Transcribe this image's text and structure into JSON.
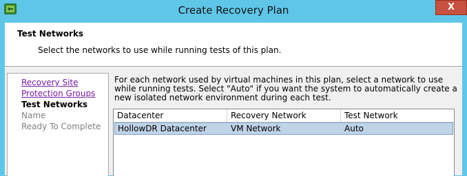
{
  "window": {
    "title": "Create Recovery Plan",
    "close_label": "X",
    "app_icon": "vmware-srm-icon"
  },
  "header": {
    "title": "Test Networks",
    "subtitle": "Select the networks to use while running tests of this plan."
  },
  "nav": {
    "items": [
      {
        "label": "Recovery Site",
        "state": "link"
      },
      {
        "label": "Protection Groups",
        "state": "link"
      },
      {
        "label": "Test Networks",
        "state": "current"
      },
      {
        "label": "Name",
        "state": "disabled"
      },
      {
        "label": "Ready To Complete",
        "state": "disabled"
      }
    ]
  },
  "main": {
    "description": "For each network used by virtual machines in this plan, select a network to use while running tests. Select \"Auto\" if you want the system to automatically create a new isolated network environment during each test.",
    "table": {
      "columns": [
        "Datacenter",
        "Recovery Network",
        "Test Network"
      ],
      "rows": [
        [
          "HollowDR Datacenter",
          "VM Network",
          "Auto"
        ]
      ]
    }
  },
  "colors": {
    "titlebar": "#5fc6e8",
    "close_button": "#c7503f",
    "link": "#7a1aa8",
    "selected_row": "#c0d4e8"
  }
}
